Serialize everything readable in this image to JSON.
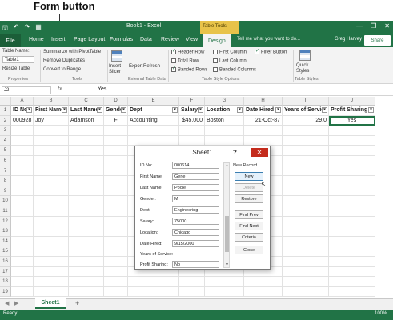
{
  "annotation": {
    "label": "Form button"
  },
  "titlebar": {
    "qat_save": "🖫",
    "qat_undo": "↶",
    "qat_redo": "↷",
    "qat_form": "▦",
    "doc_title": "Book1 - Excel",
    "contextual_tab": "Table Tools",
    "minimize": "—",
    "restore": "❐",
    "close": "✕"
  },
  "tabs": {
    "file": "File",
    "home": "Home",
    "insert": "Insert",
    "page_layout": "Page Layout",
    "formulas": "Formulas",
    "data": "Data",
    "review": "Review",
    "view": "View",
    "design": "Design",
    "tell_me": "Tell me what you want to do...",
    "user": "Greg Harvey",
    "share": "Share"
  },
  "ribbon": {
    "table_name_label": "Table Name:",
    "table_name_value": "Table1",
    "resize_table": "Resize Table",
    "properties_group": "Properties",
    "summarize": "Summarize with PivotTable",
    "remove_duplicates": "Remove Duplicates",
    "convert_range": "Convert to Range",
    "tools_group": "Tools",
    "insert_slicer": "Insert Slicer",
    "export": "Export",
    "refresh": "Refresh",
    "ext_group": "External Table Data",
    "header_row": "Header Row",
    "total_row": "Total Row",
    "banded_rows": "Banded Rows",
    "first_column": "First Column",
    "last_column": "Last Column",
    "banded_columns": "Banded Columns",
    "filter_button": "Filter Button",
    "style_options_group": "Table Style Options",
    "quick_styles": "Quick Styles",
    "styles_group": "Table Styles"
  },
  "formula_bar": {
    "name_box": "J2",
    "fx": "fx",
    "formula": "Yes"
  },
  "grid": {
    "columns": [
      "A",
      "B",
      "C",
      "D",
      "E",
      "F",
      "G",
      "H",
      "I",
      "J"
    ],
    "rows": [
      "1",
      "2",
      "3",
      "4",
      "5",
      "6",
      "7",
      "8",
      "9",
      "10",
      "11",
      "12",
      "13",
      "14",
      "15",
      "16",
      "17",
      "18",
      "19"
    ],
    "headers": [
      "ID No",
      "First Name",
      "Last Name",
      "Gender",
      "Dept",
      "Salary",
      "Location",
      "Date Hired",
      "Years of Service",
      "Profit Sharing"
    ],
    "row2": [
      "000928",
      "Joy",
      "Adamson",
      "F",
      "Accounting",
      "$45,000",
      "Boston",
      "21-Oct-87",
      "29.0",
      "Yes"
    ]
  },
  "sheet": {
    "tab": "Sheet1",
    "add": "+"
  },
  "status": {
    "ready": "Ready",
    "zoom": "100%"
  },
  "dialog": {
    "title": "Sheet1",
    "help": "?",
    "close": "✕",
    "new_record": "New Record",
    "fields": [
      {
        "label": "ID No:",
        "value": "000614"
      },
      {
        "label": "First Name:",
        "value": "Gene"
      },
      {
        "label": "Last Name:",
        "value": "Poole"
      },
      {
        "label": "Gender:",
        "value": "M"
      },
      {
        "label": "Dept:",
        "value": "Engineering"
      },
      {
        "label": "Salary:",
        "value": "75000"
      },
      {
        "label": "Location:",
        "value": "Chicago"
      },
      {
        "label": "Date Hired:",
        "value": "9/15/2000"
      },
      {
        "label": "Years of Service:",
        "value": ""
      },
      {
        "label": "Profit Sharing:",
        "value": "No"
      }
    ],
    "buttons": {
      "new": "New",
      "delete": "Delete",
      "restore": "Restore",
      "find_prev": "Find Prev",
      "find_next": "Find Next",
      "criteria": "Criteria",
      "close": "Close"
    }
  }
}
